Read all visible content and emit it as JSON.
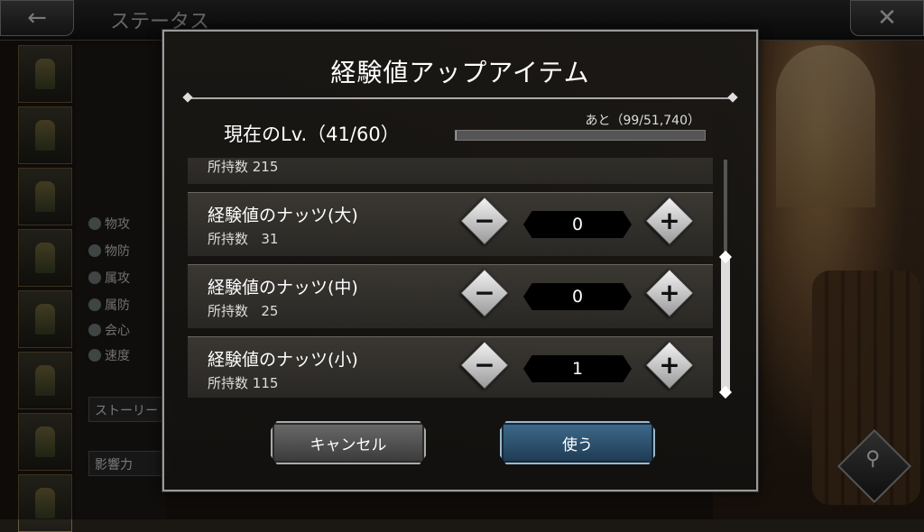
{
  "screen": {
    "title": "ステータス"
  },
  "background_stats": [
    {
      "label": "物攻"
    },
    {
      "label": "物防"
    },
    {
      "label": "属攻"
    },
    {
      "label": "属防"
    },
    {
      "label": "会心"
    },
    {
      "label": "速度"
    }
  ],
  "background_misc": {
    "story": "ストーリー",
    "influence": "影響力"
  },
  "dialog": {
    "title": "経験値アップアイテム",
    "current_level_label": "現在のLv.（41/60）",
    "remaining_exp": "あと（99/51,740）",
    "exp_progress_fraction": 0.0019,
    "partial_row_owned": "所持数 215",
    "items": [
      {
        "name": "経験値のナッツ(大)",
        "owned_label": "所持数",
        "owned": "31",
        "quantity": "0"
      },
      {
        "name": "経験値のナッツ(中)",
        "owned_label": "所持数",
        "owned": "25",
        "quantity": "0"
      },
      {
        "name": "経験値のナッツ(小)",
        "owned_label": "所持数",
        "owned": "115",
        "quantity": "1"
      }
    ],
    "cancel_label": "キャンセル",
    "use_label": "使う"
  },
  "icons": {
    "back": "←",
    "close": "✕",
    "minus": "−",
    "plus": "+",
    "search": "⚲"
  }
}
